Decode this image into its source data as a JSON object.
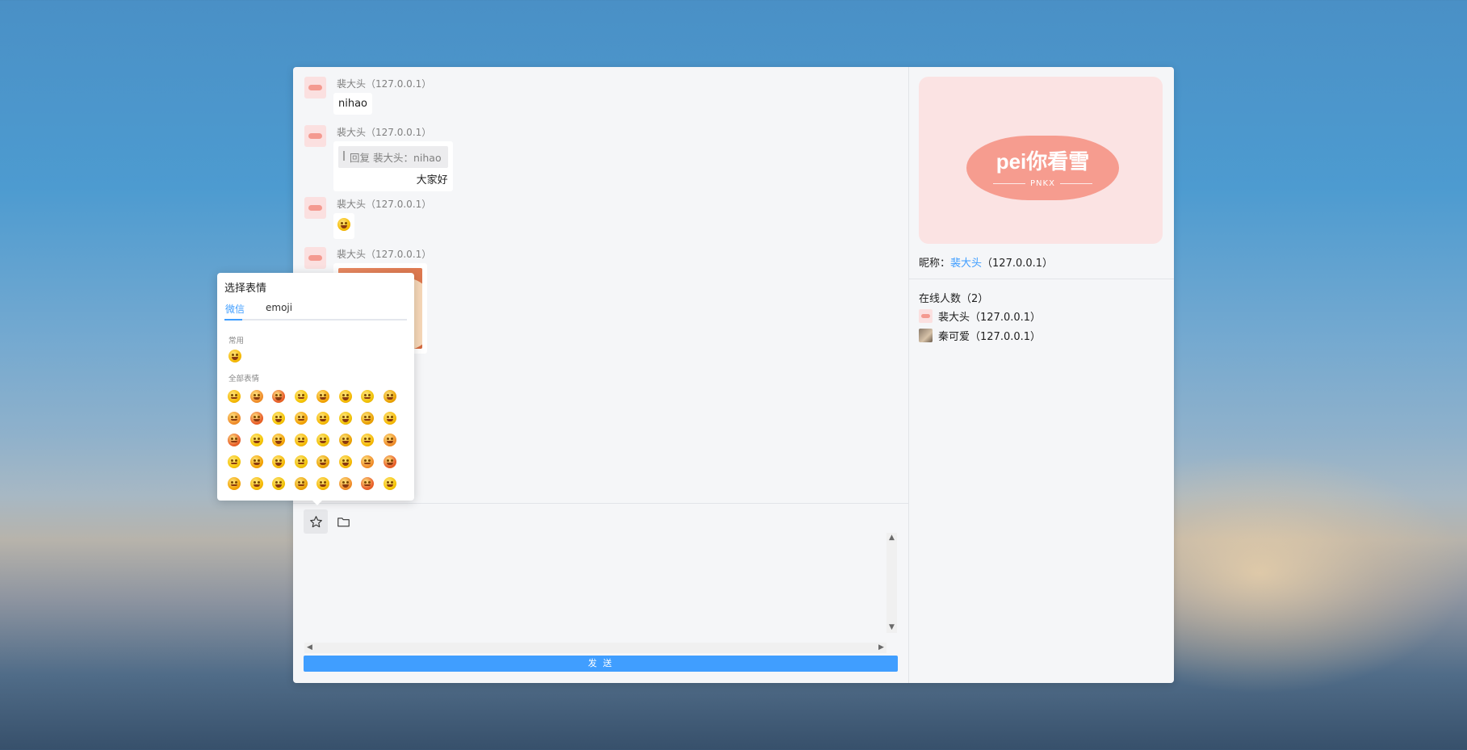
{
  "chat": {
    "messages": [
      {
        "sender": "裴大头",
        "ip": "（127.0.0.1）",
        "text": "nihao"
      },
      {
        "sender": "裴大头",
        "ip": "（127.0.0.1）",
        "quote": "回复 裴大头：nihao",
        "text": "大家好"
      },
      {
        "sender": "裴大头",
        "ip": "（127.0.0.1）",
        "emoji": "grin-emoji"
      },
      {
        "sender": "裴大头",
        "ip": "（127.0.0.1）",
        "image": "sticker-image"
      }
    ]
  },
  "toolbar": {
    "emoji_icon": "star-icon",
    "file_icon": "folder-icon"
  },
  "composer": {
    "send_label": "发 送"
  },
  "sidebar": {
    "cover": {
      "title": "pei你看雪",
      "subtitle": "PNKX"
    },
    "nick_label": "昵称：",
    "nick_name": "裴大头",
    "nick_ip": "（127.0.0.1）",
    "online_title": "在线人数（2）",
    "users": [
      {
        "name": "裴大头",
        "ip": "（127.0.0.1）"
      },
      {
        "name": "秦可爱",
        "ip": "（127.0.0.1）"
      }
    ]
  },
  "emoji_picker": {
    "title": "选择表情",
    "tabs": [
      "微信",
      "emoji"
    ],
    "active_tab": "微信",
    "section_common": "常用",
    "section_all": "全部表情"
  },
  "colors": {
    "accent": "#409eff",
    "brand_pink": "#f69c8f"
  }
}
